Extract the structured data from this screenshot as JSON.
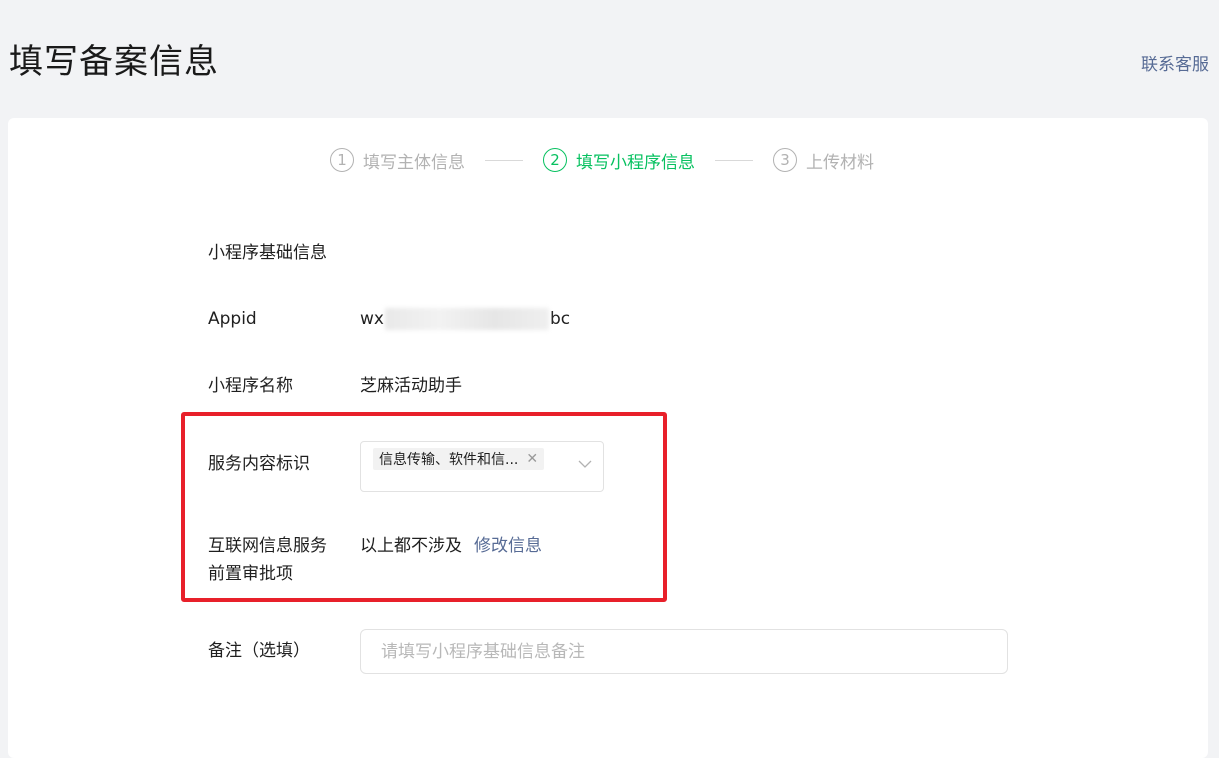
{
  "header": {
    "title": "填写备案信息",
    "contact_link": "联系客服"
  },
  "steps": [
    {
      "num": "1",
      "label": "填写主体信息",
      "state": "inactive"
    },
    {
      "num": "2",
      "label": "填写小程序信息",
      "state": "active"
    },
    {
      "num": "3",
      "label": "上传材料",
      "state": "inactive"
    }
  ],
  "form": {
    "section_title": "小程序基础信息",
    "appid": {
      "label": "Appid",
      "value_prefix": "wx",
      "value_suffix": "bc"
    },
    "name": {
      "label": "小程序名称",
      "value": "芝麻活动助手"
    },
    "service_content": {
      "label": "服务内容标识",
      "selected_tag": "信息传输、软件和信..."
    },
    "pre_approval": {
      "label_line1": "互联网信息服务",
      "label_line2": "前置审批项",
      "value": "以上都不涉及",
      "modify_link": "修改信息"
    },
    "remark": {
      "label": "备注（选填）",
      "placeholder": "请填写小程序基础信息备注",
      "value": ""
    }
  },
  "colors": {
    "accent_green": "#07c160",
    "link_blue": "#576b95",
    "highlight_red": "#e8202a"
  },
  "icons": {
    "tag_close": "close-icon",
    "select_arrow": "chevron-down-icon"
  }
}
